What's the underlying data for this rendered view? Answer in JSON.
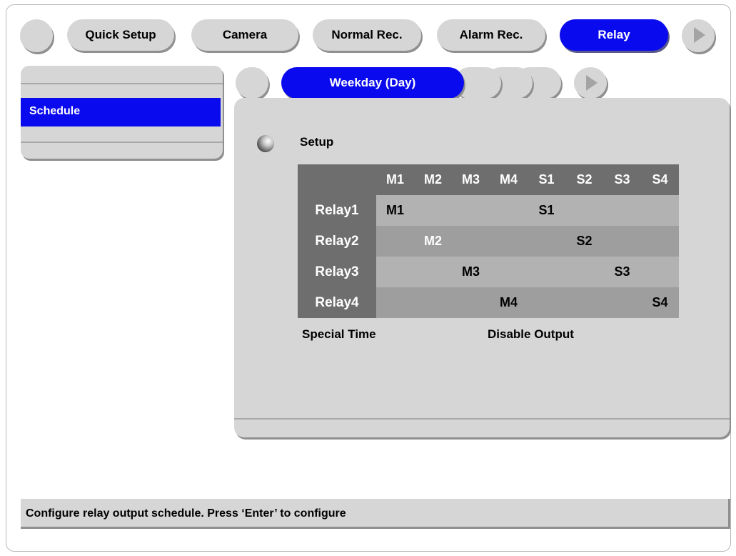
{
  "top_tabs": [
    "Quick Setup",
    "Camera",
    "Normal Rec.",
    "Alarm Rec.",
    "Relay"
  ],
  "active_top_tab": "Relay",
  "left_menu": {
    "items": [
      "Schedule"
    ],
    "selected": "Schedule"
  },
  "sub_tabs": {
    "active_label": "Weekday (Day)"
  },
  "setup": {
    "label": "Setup"
  },
  "relay_table": {
    "columns": [
      "M1",
      "M2",
      "M3",
      "M4",
      "S1",
      "S2",
      "S3",
      "S4"
    ],
    "rows": [
      {
        "label": "Relay1",
        "cells": [
          "M1",
          "",
          "",
          "",
          "S1",
          "",
          "",
          ""
        ],
        "selected_col": -1
      },
      {
        "label": "Relay2",
        "cells": [
          "",
          "M2",
          "",
          "",
          "",
          "S2",
          "",
          ""
        ],
        "selected_col": 1
      },
      {
        "label": "Relay3",
        "cells": [
          "",
          "",
          "M3",
          "",
          "",
          "",
          "S3",
          ""
        ],
        "selected_col": -1
      },
      {
        "label": "Relay4",
        "cells": [
          "",
          "",
          "",
          "M4",
          "",
          "",
          "",
          "S4"
        ],
        "selected_col": -1
      }
    ]
  },
  "special_time_label": "Special Time",
  "disable_output_label": "Disable Output",
  "status_bar": {
    "text": "Configure relay output schedule. Press ‘Enter’ to configure"
  },
  "colors": {
    "active_blue": "#0a0aee",
    "panel_gray": "#d6d6d6",
    "table_header": "#6e6e6e"
  }
}
